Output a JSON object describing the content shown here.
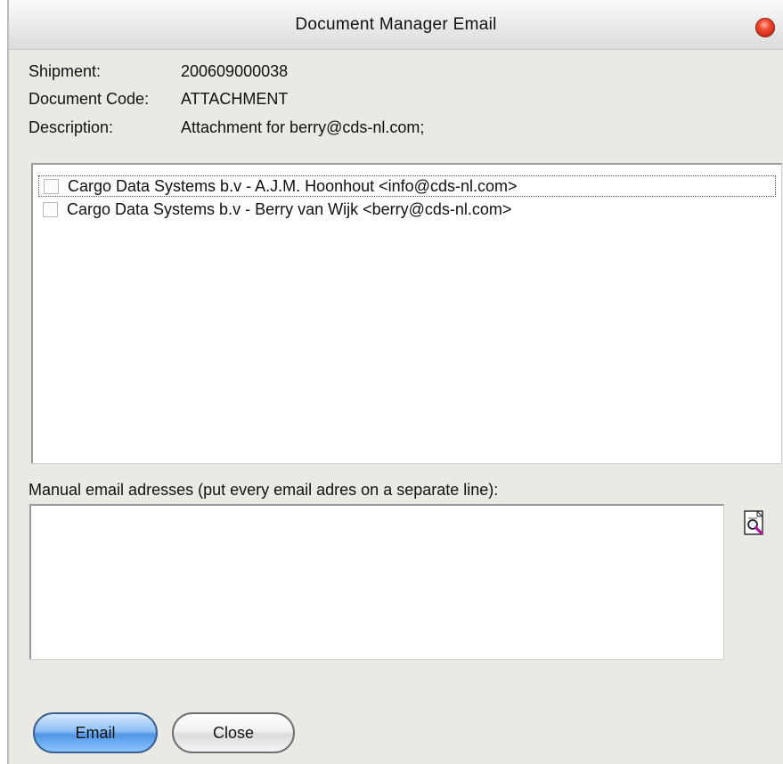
{
  "window": {
    "title": "Document Manager Email"
  },
  "info": {
    "shipment_label": "Shipment:",
    "shipment_value": "200609000038",
    "doc_code_label": "Document Code:",
    "doc_code_value": "ATTACHMENT",
    "description_label": "Description:",
    "description_value": "Attachment for berry@cds-nl.com;"
  },
  "recipients": [
    {
      "label": "Cargo Data Systems b.v - A.J.M. Hoonhout <info@cds-nl.com>",
      "checked": false,
      "focused": true
    },
    {
      "label": "Cargo Data Systems b.v - Berry van Wijk <berry@cds-nl.com>",
      "checked": false,
      "focused": false
    }
  ],
  "manual": {
    "label": "Manual email adresses (put every email adres on a separate line):",
    "value": ""
  },
  "buttons": {
    "email_label": "Email",
    "close_label": "Close"
  },
  "icons": {
    "close_dot": "close-window-icon",
    "address_book": "address-book-lookup-icon"
  },
  "colors": {
    "close_dot": "#e0381e",
    "email_button": "#6aa8ee",
    "window_bg": "#ebe9e4"
  }
}
